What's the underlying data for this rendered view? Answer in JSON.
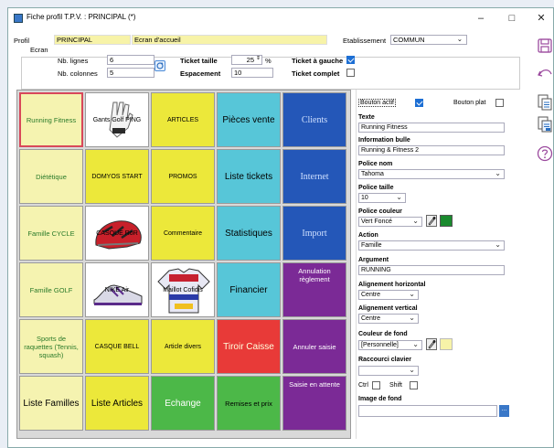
{
  "window": {
    "title": "Fiche profil T.P.V. : PRINCIPAL (*)",
    "min": "–",
    "max": "□",
    "close": "✕"
  },
  "header": {
    "profil_label": "Profil",
    "profil_value": "PRINCIPAL",
    "profil_desc": "Ecran d'accueil",
    "etab_label": "Etablissement",
    "etab_value": "COMMUN",
    "ecran_label": "Ecran",
    "nb_lignes_label": "Nb. lignes",
    "nb_lignes": "6",
    "nb_colonnes_label": "Nb. colonnes",
    "nb_colonnes": "5",
    "ticket_taille_label": "Ticket taille",
    "ticket_taille": "25",
    "ticket_taille_unit": "%",
    "espacement_label": "Espacement",
    "espacement": "10",
    "ticket_gauche_label": "Ticket à gauche",
    "ticket_complet_label": "Ticket complet"
  },
  "tiles": [
    [
      "Running Fitness",
      "Gants Golf PING",
      "ARTICLES",
      "Pièces vente",
      "Clients"
    ],
    [
      "Diététique",
      "DOMYOS START",
      "PROMOS",
      "Liste tickets",
      "Internet"
    ],
    [
      "Famille CYCLE",
      "CASQUE RoR",
      "Commentaire",
      "Statistiques",
      "Import"
    ],
    [
      "Famille GOLF",
      "NIKE Air",
      "Maillot Cofidis",
      "Financier",
      "Annulation règlement"
    ],
    [
      "Sports de raquettes (Tennis, squash)",
      "CASQUE BELL",
      "Article divers",
      "Tiroir Caisse",
      "Annuler saisie"
    ],
    [
      "Liste Familles",
      "Liste Articles",
      "Echange",
      "Remises et prix",
      "Saisie en attente"
    ]
  ],
  "panel": {
    "bouton_actif": "Bouton actif",
    "bouton_plat": "Bouton plat",
    "texte_label": "Texte",
    "texte": "Running Fitness",
    "info_label": "Information bulle",
    "info": "Running & Fitness 2",
    "police_nom_label": "Police nom",
    "police_nom": "Tahoma",
    "police_taille_label": "Police taille",
    "police_taille": "10",
    "police_couleur_label": "Police couleur",
    "police_couleur": "Vert Foncé",
    "action_label": "Action",
    "action": "Famille",
    "argument_label": "Argument",
    "argument": "RUNNING",
    "align_h_label": "Alignement horizontal",
    "align_h": "Centre",
    "align_v_label": "Alignement vertical",
    "align_v": "Centre",
    "couleur_fond_label": "Couleur de fond",
    "couleur_fond": "[Personnelle]",
    "raccourci_label": "Raccourci clavier",
    "ctrl": "Ctrl",
    "shift": "Shift",
    "image_fond_label": "Image de fond",
    "browse": "..."
  },
  "colors": {
    "accent": "#1d6fd4",
    "police_couleur": "#1a8a2e",
    "fond_perso": "#f7f3a8"
  }
}
